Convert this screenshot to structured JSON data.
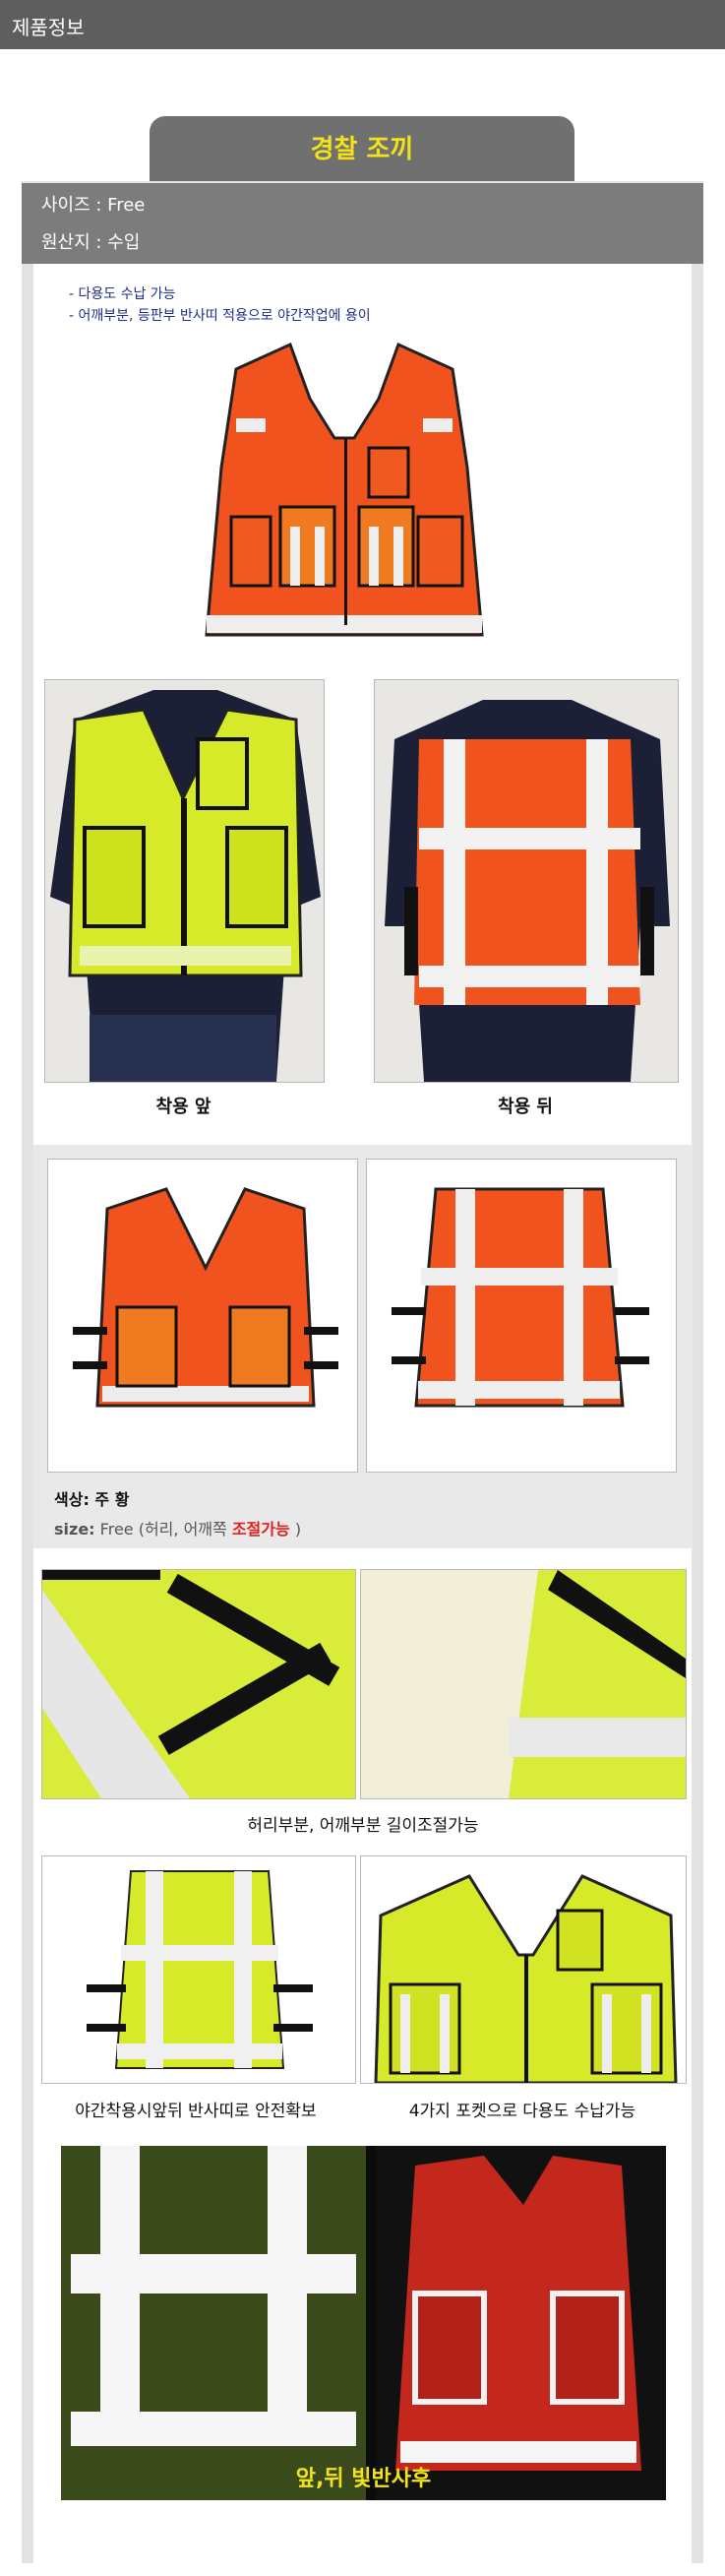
{
  "header": {
    "title": "제품정보"
  },
  "product": {
    "name": "경찰 조끼",
    "size": "사이즈 : Free",
    "origin": "원산지 : 수입"
  },
  "features": [
    "- 다용도 수납 가능",
    "- 어깨부분, 등판부 반사띠 적용으로 야간작업에 용이"
  ],
  "captions": {
    "front": "착용 앞",
    "back": "착용 뒤",
    "adjust": "허리부분, 어깨부분 길이조절가능",
    "night_safety": "야간착용시앞뒤 반사띠로 안전확보",
    "pockets": "4가지 포켓으로 다용도 수납가능",
    "reflect": "앞,뒤 빛반사후"
  },
  "color_info": {
    "color_label": "색상:",
    "color_value": "주 황",
    "size_label": "size:",
    "size_value": "Free",
    "size_note_open": "(허리, 어깨쪽",
    "size_note_highlight": "조절가능",
    "size_note_close": ")"
  },
  "colors": {
    "orange": "#f0531e",
    "lime": "#d7ea2a",
    "gold_title": "#f2e219",
    "highlight_red": "#e02020",
    "feature_blue": "#1f2e8a"
  }
}
